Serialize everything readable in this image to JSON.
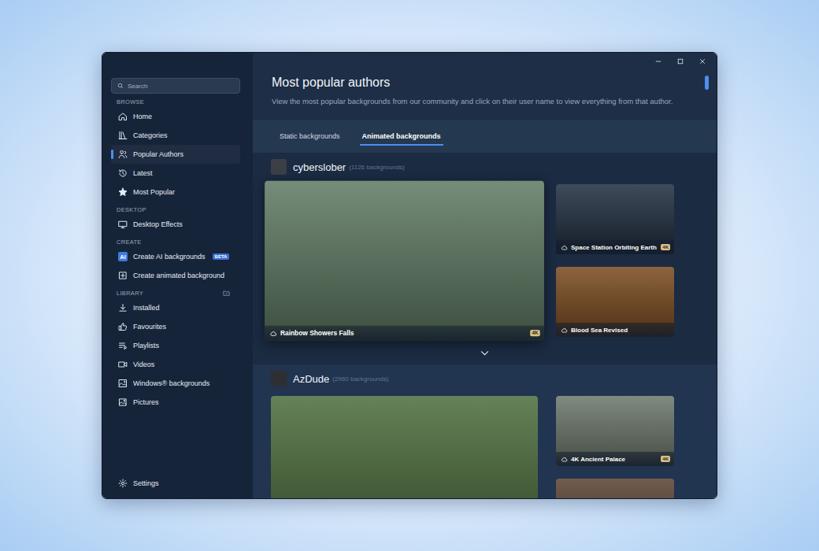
{
  "window": {
    "controls": [
      "minimize",
      "maximize",
      "close"
    ]
  },
  "sidebar": {
    "search": {
      "placeholder": "Search"
    },
    "sections": [
      {
        "title": "BROWSE",
        "action": false,
        "items": [
          {
            "label": "Home",
            "selected": false
          },
          {
            "label": "Categories",
            "selected": false
          },
          {
            "label": "Popular Authors",
            "selected": true
          },
          {
            "label": "Latest",
            "selected": false
          },
          {
            "label": "Most Popular",
            "selected": false
          }
        ]
      },
      {
        "title": "DESKTOP",
        "action": false,
        "items": [
          {
            "label": "Desktop Effects",
            "selected": false
          }
        ]
      },
      {
        "title": "CREATE",
        "action": false,
        "items": [
          {
            "label": "Create AI backgrounds",
            "selected": false,
            "icon_text": "AI",
            "badge": "BETA"
          },
          {
            "label": "Create animated background",
            "selected": false
          }
        ]
      },
      {
        "title": "LIBRARY",
        "action": true,
        "items": [
          {
            "label": "Installed",
            "selected": false
          },
          {
            "label": "Favourites",
            "selected": false
          },
          {
            "label": "Playlists",
            "selected": false
          },
          {
            "label": "Videos",
            "selected": false
          },
          {
            "label": "Windows® backgrounds",
            "selected": false
          },
          {
            "label": "Pictures",
            "selected": false
          }
        ]
      }
    ],
    "footer": {
      "label": "Settings",
      "selected": false
    }
  },
  "header": {
    "title": "Most popular authors",
    "description": "View the most popular backgrounds from our community and click on their user name to view everything from that author."
  },
  "tabs": [
    {
      "label": "Static backgrounds",
      "selected": false
    },
    {
      "label": "Animated backgrounds",
      "selected": true
    }
  ],
  "scrollbar": {
    "position": 0,
    "thumb": 0.034
  },
  "authors": [
    {
      "name": "cyberslober",
      "count": "(1126 backgrounds)",
      "avatar_color": "#3b3f46",
      "show_more": true,
      "featured": {
        "title": "Rainbow Showers Falls",
        "badge": "4K",
        "hovered": true,
        "color": "#5e7a62"
      },
      "side": [
        {
          "title": "Space Station Orbiting Earth",
          "badge": "4K",
          "hovered": false,
          "color": "#1f2d3f"
        },
        {
          "title": "Blood Sea Revised",
          "hovered": false,
          "color": "#7a4a1e"
        }
      ]
    },
    {
      "name": "AzDude",
      "count": "(2960 backgrounds)",
      "avatar_color": "#2f2f33",
      "show_more": false,
      "featured": {
        "hovered": false,
        "color": "#4c6d3c"
      },
      "side": [
        {
          "title": "4K Ancient Palace",
          "badge": "4K",
          "hovered": false,
          "color": "#6c776a"
        },
        {
          "hovered": false,
          "color": "#5a4232"
        }
      ]
    }
  ]
}
